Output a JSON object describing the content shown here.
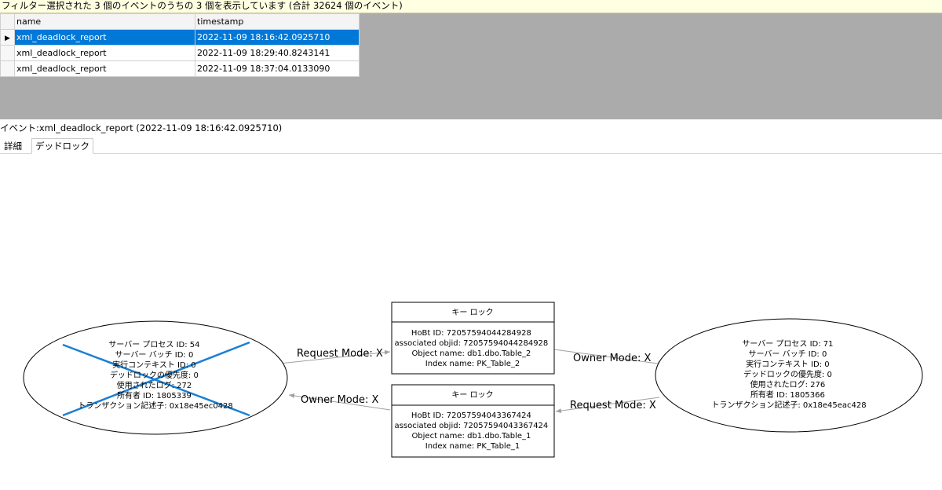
{
  "filter_bar": "フィルター選択された 3 個のイベントのうちの 3 個を表示しています (合計 32624 個のイベント)",
  "grid": {
    "columns": [
      "name",
      "timestamp"
    ],
    "rows": [
      {
        "name": "xml_deadlock_report",
        "timestamp": "2022-11-09 18:16:42.0925710",
        "selected": true
      },
      {
        "name": "xml_deadlock_report",
        "timestamp": "2022-11-09 18:29:40.8243141",
        "selected": false
      },
      {
        "name": "xml_deadlock_report",
        "timestamp": "2022-11-09 18:37:04.0133090",
        "selected": false
      }
    ]
  },
  "event_title": "イベント:xml_deadlock_report (2022-11-09 18:16:42.0925710)",
  "tabs": [
    "詳細",
    "デッドロック"
  ],
  "active_tab": "デッドロック",
  "graph": {
    "victim_process": {
      "lines": [
        "サーバー プロセス ID: 54",
        "サーバー バッチ ID: 0",
        "実行コンテキスト ID: 0",
        "デッドロックの優先度: 0",
        "使用されたログ: 272",
        "所有者 ID: 1805339",
        "トランザクション記述子: 0x18e45ec0428"
      ]
    },
    "other_process": {
      "lines": [
        "サーバー プロセス ID: 71",
        "サーバー バッチ ID: 0",
        "実行コンテキスト ID: 0",
        "デッドロックの優先度: 0",
        "使用されたログ: 276",
        "所有者 ID: 1805366",
        "トランザクション記述子: 0x18e45eac428"
      ]
    },
    "lock_table2": {
      "title": "キー ロック",
      "lines": [
        "HoBt ID: 72057594044284928",
        "associated objid: 72057594044284928",
        "Object name: db1.dbo.Table_2",
        "Index name: PK_Table_2"
      ]
    },
    "lock_table1": {
      "title": "キー ロック",
      "lines": [
        "HoBt ID: 72057594043367424",
        "associated objid: 72057594043367424",
        "Object name: db1.dbo.Table_1",
        "Index name: PK_Table_1"
      ]
    },
    "edges": {
      "victim_request": "Request Mode: X",
      "lock2_owner": "Owner Mode: X",
      "other_request": "Request Mode: X",
      "lock1_owner": "Owner Mode: X"
    },
    "colors": {
      "victim_cross": "#1a7fd4",
      "edge": "#a0a0a0",
      "selection": "#0078d7"
    }
  }
}
